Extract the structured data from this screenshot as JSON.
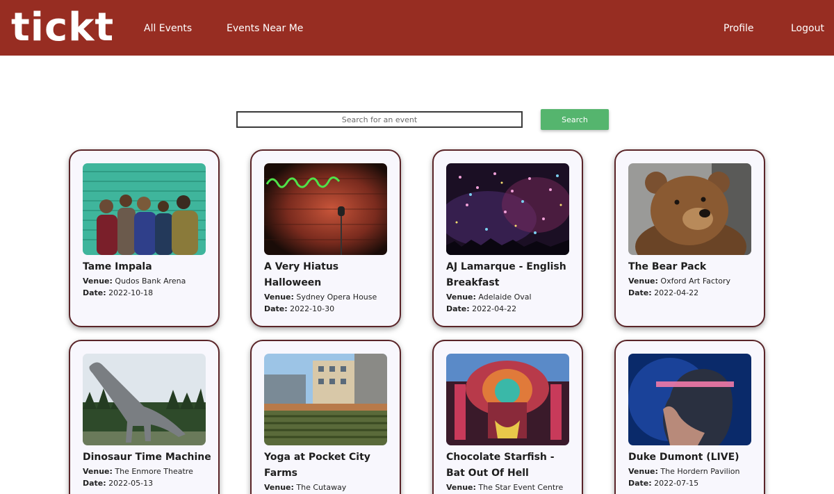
{
  "header": {
    "logo": "tickt",
    "nav_all_events": "All Events",
    "nav_events_near_me": "Events Near Me",
    "nav_profile": "Profile",
    "nav_logout": "Logout",
    "brand_color": "#972d22"
  },
  "search": {
    "placeholder": "Search for an event",
    "value": "",
    "button_label": "Search",
    "button_color": "#55b56e"
  },
  "labels": {
    "venue": "Venue:",
    "date": "Date:"
  },
  "events": [
    {
      "title": "Tame Impala",
      "venue": "Qudos Bank Arena",
      "date": "2022-10-18",
      "image": "band-photo"
    },
    {
      "title": "A Very Hiatus Halloween",
      "venue": "Sydney Opera House",
      "date": "2022-10-30",
      "image": "comedy-stage-photo"
    },
    {
      "title": "AJ Lamarque - English Breakfast",
      "venue": "Adelaide Oval",
      "date": "2022-04-22",
      "image": "confetti-concert-photo"
    },
    {
      "title": "The Bear Pack",
      "venue": "Oxford Art Factory",
      "date": "2022-04-22",
      "image": "bear-photo"
    },
    {
      "title": "Dinosaur Time Machine",
      "venue": "The Enmore Theatre",
      "date": "2022-05-13",
      "image": "dinosaur-statue-photo"
    },
    {
      "title": "Yoga at Pocket City Farms",
      "venue": "The Cutaway",
      "date": "",
      "image": "city-farm-photo"
    },
    {
      "title": "Chocolate Starfish - Bat Out Of Hell",
      "venue": "The Star Event Centre",
      "date": "",
      "image": "festival-stage-photo"
    },
    {
      "title": "Duke Dumont (LIVE)",
      "venue": "The Hordern Pavilion",
      "date": "2022-07-15",
      "image": "portrait-photo"
    }
  ]
}
